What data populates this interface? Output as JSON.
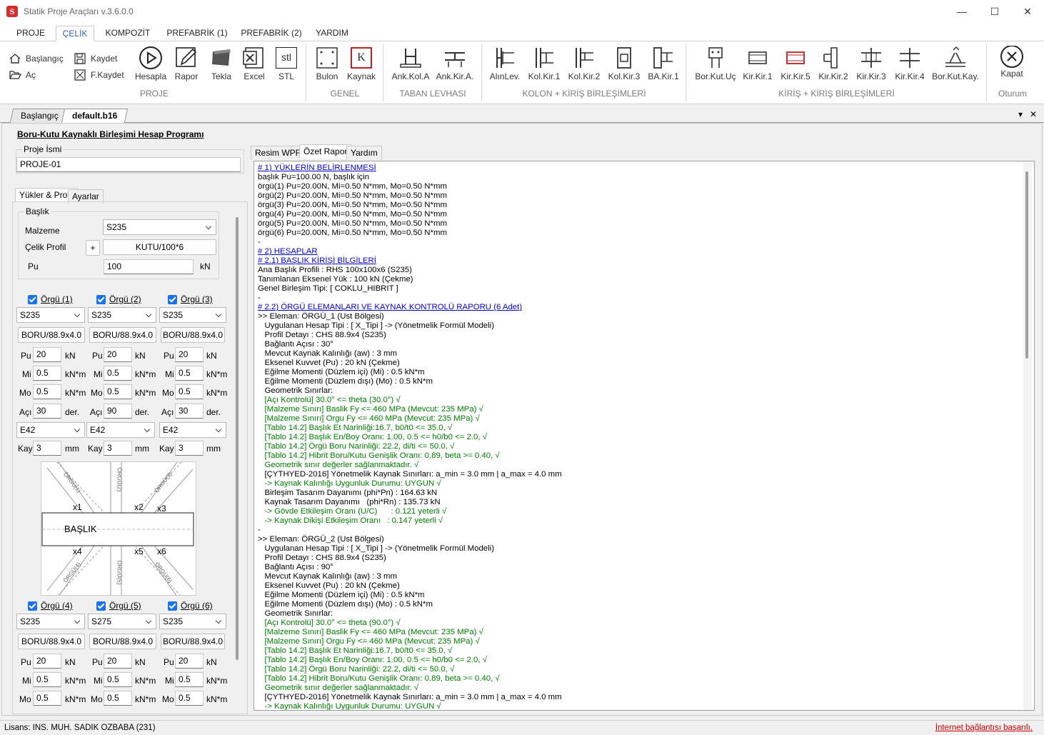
{
  "window": {
    "title": "Statik Proje Araçları v.3.6.0.0",
    "minimize": "—",
    "maximize": "☐",
    "close": "✕"
  },
  "ribbon_tabs": [
    "PROJE",
    "ÇELİK",
    "KOMPOZİT",
    "PREFABRİK (1)",
    "PREFABRİK (2)",
    "YARDIM"
  ],
  "active_ribbon_tab": "ÇELİK",
  "ribbon": {
    "proje": {
      "baslangic": "Başlangıç",
      "ac": "Aç",
      "kaydet": "Kaydet",
      "fkaydet": "F.Kaydet",
      "hesapla": "Hesapla",
      "rapor": "Rapor",
      "tekla": "Tekla",
      "excel": "Excel",
      "stl": "STL",
      "stl_icon_text": "stl",
      "group": "PROJE"
    },
    "genel": {
      "bulon": "Bulon",
      "kaynak": "Kaynak",
      "kaynak_icon_text": "K",
      "group": "GENEL"
    },
    "taban": {
      "ank_kol_a": "Ank.Kol.A",
      "ank_kir_a": "Ank.Kir.A.",
      "group": "TABAN LEVHASI"
    },
    "kolon": {
      "items": [
        "AlınLev.",
        "Kol.Kir.1",
        "Kol.Kir.2",
        "Kol.Kir.3",
        "BA.Kir.1"
      ],
      "group": "KOLON + KİRİŞ BİRLEŞİMLERİ"
    },
    "kiris": {
      "items": [
        "Bor.Kut.Uç",
        "Kir.Kir.1",
        "Kir.Kir.5",
        "Kir.Kir.2",
        "Kir.Kir.3",
        "Kir.Kir.4",
        "Bor.Kut.Kay."
      ],
      "group": "KİRİŞ + KİRİŞ BİRLEŞİMLERİ"
    },
    "oturum": {
      "kapat": "Kapat",
      "group": "Oturum"
    }
  },
  "doc_tabs": [
    "Başlangıç",
    "default.b16"
  ],
  "active_doc_tab": "default.b16",
  "doc_controls": {
    "dropdown": "▾",
    "close": "✕"
  },
  "left": {
    "program_title": "Boru-Kutu Kaynaklı Birleşimi Hesap Programı",
    "proje_ismi_label": "Proje İsmi",
    "proje_ismi_value": "PROJE-01",
    "tabs": [
      "Yükler & Profil",
      "Ayarlar"
    ],
    "baslik": {
      "title": "Başlık",
      "malzeme_label": "Malzeme",
      "malzeme_value": "S235",
      "celik_profil_label": "Çelik Profil",
      "plus": "+",
      "profil_value": "KUTU/100*6",
      "pu_label": "Pu",
      "pu_value": "100",
      "pu_unit": "kN"
    },
    "unit_labels": {
      "pu": "Pu",
      "mi": "Mi",
      "mo": "Mo",
      "aci": "Açı",
      "kay": "Kay",
      "kn": "kN",
      "knm": "kN*m",
      "der": "der.",
      "mm": "mm"
    },
    "orgu": [
      {
        "label": "Örgü (1)",
        "material": "S235",
        "profile": "BORU/88.9x4.0",
        "pu": "20",
        "mi": "0.5",
        "mo": "0.5",
        "aci": "30",
        "electrode": "E42",
        "kay": "3"
      },
      {
        "label": "Örgü (2)",
        "material": "S235",
        "profile": "BORU/88.9x4.0",
        "pu": "20",
        "mi": "0.5",
        "mo": "0.5",
        "aci": "90",
        "electrode": "E42",
        "kay": "3"
      },
      {
        "label": "Örgü (3)",
        "material": "S235",
        "profile": "BORU/88.9x4.0",
        "pu": "20",
        "mi": "0.5",
        "mo": "0.5",
        "aci": "30",
        "electrode": "E42",
        "kay": "3"
      },
      {
        "label": "Örgü (4)",
        "material": "S235",
        "profile": "BORU/88.9x4.0",
        "pu": "20",
        "mi": "0.5",
        "mo": "0.5"
      },
      {
        "label": "Örgü (5)",
        "material": "S275",
        "profile": "BORU/88.9x4.0",
        "pu": "20",
        "mi": "0.5",
        "mo": "0.5"
      },
      {
        "label": "Örgü (6)",
        "material": "S235",
        "profile": "BORU/88.9x4.0",
        "pu": "20",
        "mi": "0.5",
        "mo": "0.5"
      }
    ],
    "diagram": {
      "baslik": "BAŞLIK",
      "x1": "x1",
      "x2": "x2",
      "x3": "x3",
      "x4": "x4",
      "x5": "x5",
      "x6": "x6",
      "o1": "ÖRGÜ(1)",
      "o2": "ÖRGÜ(2)",
      "o3": "ÖRGÜ(3)",
      "o4": "ÖRGÜ(4)",
      "o5": "ÖRGÜ(5)",
      "o6": "ÖRGÜ(6)"
    }
  },
  "report_tabs": [
    "Resim WPF",
    "Özet Rapor",
    "Yardım"
  ],
  "active_report_tab": "Özet Rapor",
  "report_lines": [
    {
      "t": "# 1) YÜKLERİN BELİRLENMESİ",
      "s": "h"
    },
    {
      "t": "başlık Pu=100.00 N, başlık için",
      "s": ""
    },
    {
      "t": "örgü(1) Pu=20.00N, Mi=0.50 N*mm, Mo=0.50 N*mm",
      "s": ""
    },
    {
      "t": "örgü(2) Pu=20.00N, Mi=0.50 N*mm, Mo=0.50 N*mm",
      "s": ""
    },
    {
      "t": "örgü(3) Pu=20.00N, Mi=0.50 N*mm, Mo=0.50 N*mm",
      "s": ""
    },
    {
      "t": "örgü(4) Pu=20.00N, Mi=0.50 N*mm, Mo=0.50 N*mm",
      "s": ""
    },
    {
      "t": "örgü(5) Pu=20.00N, Mi=0.50 N*mm, Mo=0.50 N*mm",
      "s": ""
    },
    {
      "t": "örgü(6) Pu=20.00N, Mi=0.50 N*mm, Mo=0.50 N*mm",
      "s": ""
    },
    {
      "t": "-",
      "s": ""
    },
    {
      "t": "# 2) HESAPLAR",
      "s": "h"
    },
    {
      "t": "# 2.1) BAŞLIK KİRİŞİ BİLGİLERİ",
      "s": "h"
    },
    {
      "t": "Ana Başlık Profili : RHS 100x100x6 (S235)",
      "s": ""
    },
    {
      "t": "Tanımlanan Eksenel Yük : 100 kN (Çekme)",
      "s": ""
    },
    {
      "t": "Genel Birleşim Tipi: [ COKLU_HIBRIT ]",
      "s": ""
    },
    {
      "t": "-",
      "s": ""
    },
    {
      "t": "# 2.2) ÖRGÜ ELEMANLARI VE KAYNAK KONTROLÜ RAPORU (6 Adet)",
      "s": "h"
    },
    {
      "t": ">> Eleman: ÖRGÜ_1 (Ust Bölgesi)",
      "s": ""
    },
    {
      "t": "   Uygulanan Hesap Tipi : [ X_Tipi ] -> (Yönetmelik Formül Modeli)",
      "s": ""
    },
    {
      "t": "   Profil Detayı : CHS 88.9x4 (S235)",
      "s": ""
    },
    {
      "t": "   Bağlantı Açısı : 30°",
      "s": ""
    },
    {
      "t": "   Mevcut Kaynak Kalınlığı (aw) : 3 mm",
      "s": ""
    },
    {
      "t": "   Eksenel Kuvvet (Pu) : 20 kN (Çekme)",
      "s": ""
    },
    {
      "t": "   Eğilme Momenti (Düzlem içi) (Mi) : 0.5 kN*m",
      "s": ""
    },
    {
      "t": "   Eğilme Momenti (Düzlem dışı) (Mo) : 0.5 kN*m",
      "s": ""
    },
    {
      "t": "   Geometrik Sınırlar:",
      "s": ""
    },
    {
      "t": "   [Açı Kontrolü] 30.0° <= theta (30.0°) √",
      "s": "g"
    },
    {
      "t": "   [Malzeme Sınırı] Baslik Fy <= 460 MPa (Mevcut: 235 MPa) √",
      "s": "g"
    },
    {
      "t": "   [Malzeme Sınırı] Orgu Fy <= 460 MPa (Mevcut: 235 MPa) √",
      "s": "g"
    },
    {
      "t": "   [Tablo 14.2] Başlık Et Narinliği:16.7, b0/t0 <= 35.0, √",
      "s": "g"
    },
    {
      "t": "   [Tablo 14.2] Başlık En/Boy Oranı: 1.00, 0.5 <= h0/b0 <= 2.0, √",
      "s": "g"
    },
    {
      "t": "   [Tablo 14.2] Örgü Boru Narinliği: 22.2, di/ti <= 50.0, √",
      "s": "g"
    },
    {
      "t": "   [Tablo 14.2] Hibrit Boru/Kutu Genişlik Oranı: 0.89, beta >= 0.40, √",
      "s": "g"
    },
    {
      "t": "   Geometrik sınır değerler sağlanmaktadır. √",
      "s": "g"
    },
    {
      "t": "   [ÇYTHYED-2016] Yönetmelik Kaynak Sınırları: a_min = 3.0 mm | a_max = 4.0 mm",
      "s": ""
    },
    {
      "t": "   -> Kaynak Kalınlığı Uygunluk Durumu: UYGUN √",
      "s": "g"
    },
    {
      "t": "   Birleşim Tasarım Dayanımı (phi*Pn) : 164.63 kN",
      "s": ""
    },
    {
      "t": "   Kaynak Tasarım Dayanımı   (phi*Rn) : 135.73 kN",
      "s": ""
    },
    {
      "t": "   -> Gövde Etkileşim Oranı (U/C)      : 0.121 yeterli √",
      "s": "g"
    },
    {
      "t": "   -> Kaynak Dikişi Etkileşim Oranı   : 0.147 yeterli √",
      "s": "g"
    },
    {
      "t": "-",
      "s": ""
    },
    {
      "t": ">> Eleman: ÖRGÜ_2 (Ust Bölgesi)",
      "s": ""
    },
    {
      "t": "   Uygulanan Hesap Tipi : [ X_Tipi ] -> (Yönetmelik Formül Modeli)",
      "s": ""
    },
    {
      "t": "   Profil Detayı : CHS 88.9x4 (S235)",
      "s": ""
    },
    {
      "t": "   Bağlantı Açısı : 90°",
      "s": ""
    },
    {
      "t": "   Mevcut Kaynak Kalınlığı (aw) : 3 mm",
      "s": ""
    },
    {
      "t": "   Eksenel Kuvvet (Pu) : 20 kN (Çekme)",
      "s": ""
    },
    {
      "t": "   Eğilme Momenti (Düzlem içi) (Mi) : 0.5 kN*m",
      "s": ""
    },
    {
      "t": "   Eğilme Momenti (Düzlem dışı) (Mo) : 0.5 kN*m",
      "s": ""
    },
    {
      "t": "   Geometrik Sınırlar:",
      "s": ""
    },
    {
      "t": "   [Açı Kontrolü] 30.0° <= theta (90.0°) √",
      "s": "g"
    },
    {
      "t": "   [Malzeme Sınırı] Baslik Fy <= 460 MPa (Mevcut: 235 MPa) √",
      "s": "g"
    },
    {
      "t": "   [Malzeme Sınırı] Orgu Fy <= 460 MPa (Mevcut: 235 MPa) √",
      "s": "g"
    },
    {
      "t": "   [Tablo 14.2] Başlık Et Narinliği:16.7, b0/t0 <= 35.0, √",
      "s": "g"
    },
    {
      "t": "   [Tablo 14.2] Başlık En/Boy Oranı: 1.00, 0.5 <= h0/b0 <= 2.0, √",
      "s": "g"
    },
    {
      "t": "   [Tablo 14.2] Örgü Boru Narinliği: 22.2, di/ti <= 50.0, √",
      "s": "g"
    },
    {
      "t": "   [Tablo 14.2] Hibrit Boru/Kutu Genişlik Oranı: 0.89, beta >= 0.40, √",
      "s": "g"
    },
    {
      "t": "   Geometrik sınır değerler sağlanmaktadır. √",
      "s": "g"
    },
    {
      "t": "   [ÇYTHYED-2016] Yönetmelik Kaynak Sınırları: a_min = 3.0 mm | a_max = 4.0 mm",
      "s": ""
    },
    {
      "t": "   -> Kaynak Kalınlığı Uygunluk Durumu: UYGUN √",
      "s": "g"
    }
  ],
  "status": {
    "license": "Lisans: INS. MUH. SADIK OZBABA (231)",
    "connection": "İnternet bağlantısı başarılı."
  },
  "colors": {
    "accent": "#2b67c4",
    "heading": "#0000cc",
    "ok": "#008000",
    "error": "#d00000"
  }
}
